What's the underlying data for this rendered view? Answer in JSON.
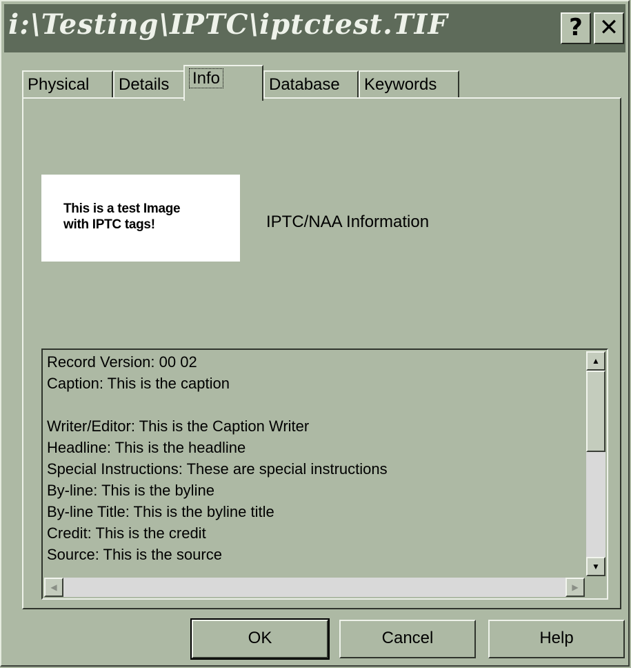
{
  "window": {
    "title": "i:\\Testing\\IPTC\\iptctest.TIF",
    "help_glyph": "?",
    "close_glyph": "✕"
  },
  "tabs": [
    {
      "label": "Physical",
      "active": false
    },
    {
      "label": "Details",
      "active": false
    },
    {
      "label": "Info",
      "active": true
    },
    {
      "label": "Database",
      "active": false
    },
    {
      "label": "Keywords",
      "active": false
    }
  ],
  "info": {
    "preview_text": "This is a test Image\nwith IPTC tags!",
    "heading": "IPTC/NAA Information",
    "lines": [
      "Record Version: 00 02",
      "Caption: This is the caption",
      "",
      "Writer/Editor: This is the Caption Writer",
      "Headline: This is the headline",
      "Special Instructions: These are special instructions",
      "By-line: This is the byline",
      "By-line Title: This is the byline title",
      "Credit: This is the credit",
      "Source: This is the source"
    ],
    "scroll_up_glyph": "▲",
    "scroll_down_glyph": "▼",
    "scroll_left_glyph": "◀",
    "scroll_right_glyph": "▶"
  },
  "buttons": {
    "ok": "OK",
    "cancel": "Cancel",
    "help": "Help"
  },
  "colors": {
    "dialog_bg": "#adb9a4",
    "titlebar": "#5e6b5a"
  }
}
